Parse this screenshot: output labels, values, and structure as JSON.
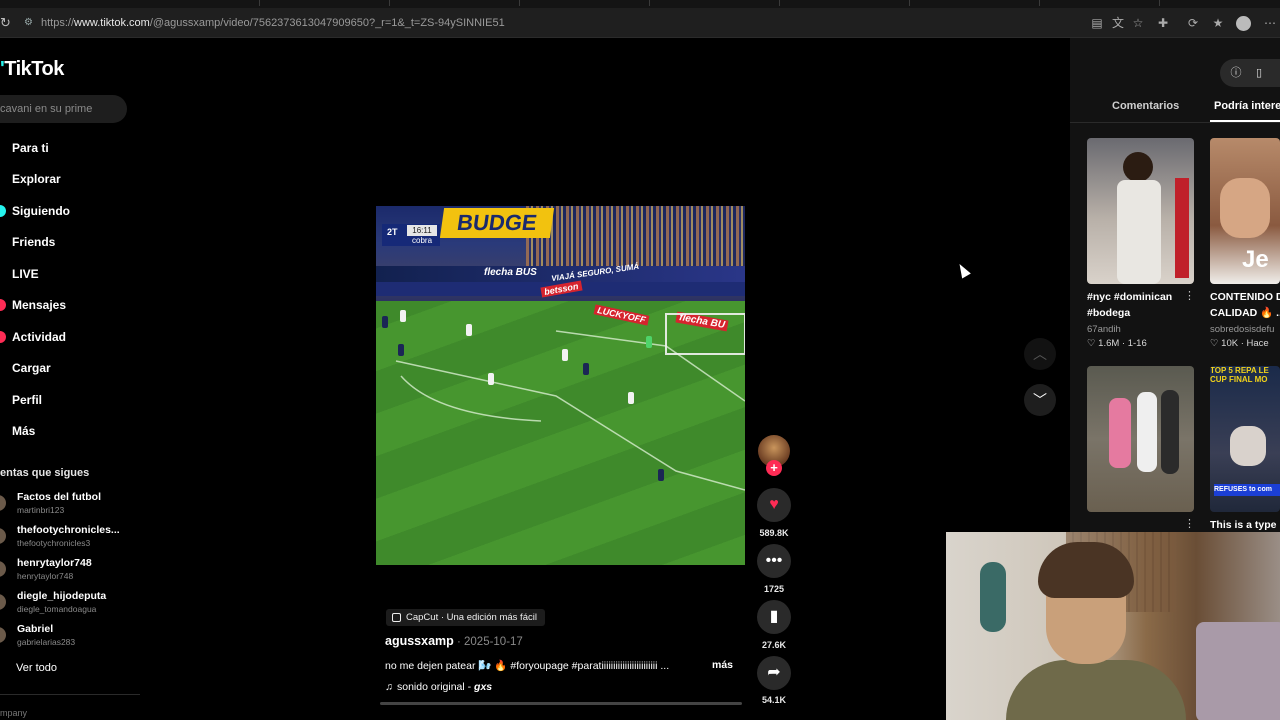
{
  "browser": {
    "url_prefix": "https://",
    "url_host": "www.tiktok.com",
    "url_path": "/@agussxamp/video/7562373613047909650?_r=1&_t=ZS-94ySINNIE51"
  },
  "sidebar": {
    "logo": "TikTok",
    "search_placeholder": "cavani en su prime",
    "nav": [
      {
        "label": "Para ti",
        "dot_color": null
      },
      {
        "label": "Explorar",
        "dot_color": null
      },
      {
        "label": "Siguiendo",
        "dot_color": "#25f4ee"
      },
      {
        "label": "Friends",
        "dot_color": null
      },
      {
        "label": "LIVE",
        "dot_color": null
      },
      {
        "label": "Mensajes",
        "dot_color": "#fe2c55"
      },
      {
        "label": "Actividad",
        "dot_color": "#fe2c55"
      },
      {
        "label": "Cargar",
        "dot_color": null
      },
      {
        "label": "Perfil",
        "dot_color": null
      },
      {
        "label": "Más",
        "dot_color": null
      }
    ],
    "following_title": "entas que sigues",
    "accounts": [
      {
        "name": "Factos del futbol",
        "handle": "martinbri123"
      },
      {
        "name": "thefootychronicles...",
        "handle": "thefootychronicles3"
      },
      {
        "name": "henrytaylor748",
        "handle": "henrytaylor748"
      },
      {
        "name": "diegle_hijodeputa",
        "handle": "diegle_tomandoagua"
      },
      {
        "name": "Gabriel",
        "handle": "gabrielarias283"
      }
    ],
    "see_all": "Ver todo",
    "company": "mpany"
  },
  "video": {
    "scorebug": {
      "half": "2T",
      "clock": "16:11",
      "brand": "cobra"
    },
    "ads": {
      "budge": "BUDGE",
      "flecha_bus": "flecha BUS",
      "betsson": "betsson",
      "viaja": "VIAJÁ SEGURO, SUMÁ",
      "lucky": "LUCKYOFF",
      "flecha_bus2": "flecha BU"
    },
    "capcut_label": "CapCut · Una edición más fácil",
    "author": "agussxamp",
    "date": " · 2025-10-17",
    "description": "no me dejen patear 🌬️ 🔥 #foryoupage #paratiiiiiiiiiiiiiiiiiiiiiiii ...",
    "more": "más",
    "sound": "sonido original - ",
    "sound_artist": "gxs",
    "progress": 0.0
  },
  "actions": {
    "likes": "589.8K",
    "comments": "1725",
    "saves": "27.6K",
    "shares": "54.1K"
  },
  "right_panel": {
    "tabs": [
      {
        "label": "Comentarios",
        "active": false
      },
      {
        "label": "Podría intere",
        "active": true
      }
    ],
    "videos": [
      {
        "title_line1": "#nyc #dominican",
        "title_line2": "#bodega",
        "user": "67andih",
        "stats": "♡ 1.6M · 1-16"
      },
      {
        "title_line1": "CONTENIDO D",
        "title_line2": "CALIDAD 🔥 ...",
        "user": "sobredosisdefu",
        "stats": "♡ 10K · Hace"
      },
      {
        "title_line1": "",
        "title_line2": "",
        "user": "",
        "stats": ""
      },
      {
        "title_line1": "This is a type",
        "title_line2": "",
        "user": "",
        "stats": ""
      }
    ],
    "thumb_text": {
      "top_right": "Je",
      "bottom_right_top": "TOP 5 REPA LE CUP FINAL MO",
      "bottom_right_tag": "REFUSES to com"
    }
  }
}
